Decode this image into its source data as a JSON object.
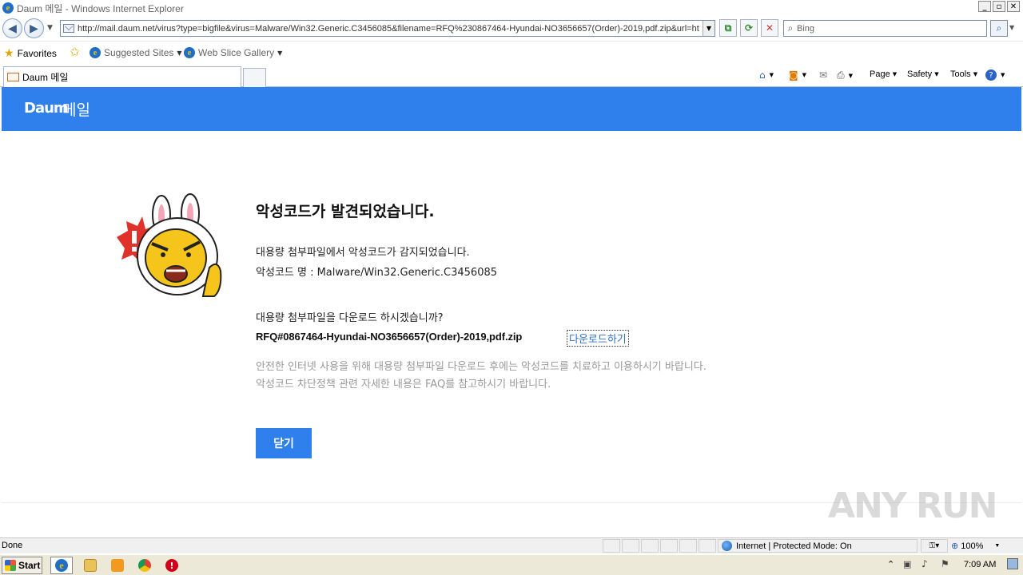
{
  "window": {
    "title": "Daum 메일 - Windows Internet Explorer",
    "minimize": "_",
    "maximize": "▫",
    "close": "✕"
  },
  "address": {
    "url": "http://mail.daum.net/virus?type=bigfile&virus=Malware/Win32.Generic.C3456085&filename=RFQ%230867464-Hyundai-NO3656657(Order)-2019,pdf.zip&url=ht",
    "search_placeholder": "Bing"
  },
  "favorites_bar": {
    "favorites_label": "Favorites",
    "suggested_sites": "Suggested Sites",
    "web_slice_gallery": "Web Slice Gallery"
  },
  "tabs": {
    "active_tab_label": "Daum 메일"
  },
  "command_bar": {
    "page": "Page",
    "safety": "Safety",
    "tools": "Tools"
  },
  "page": {
    "logo": "Daum",
    "service": "메일",
    "title": "악성코드가 발견되었습니다.",
    "desc1": "대용량 첨부파일에서 악성코드가 감지되었습니다.",
    "desc2": "악성코드 명 : Malware/Win32.Generic.C3456085",
    "question": "대용량 첨부파일을 다운로드 하시겠습니까?",
    "filename": "RFQ#0867464-Hyundai-NO3656657(Order)-2019,pdf.zip",
    "download_link": "다운로드하기",
    "note1": "안전한 인터넷 사용을 위해 대용량 첨부파일 다운로드 후에는 악성코드를 치료하고 이용하시기 바랍니다.",
    "note2": "악성코드 차단정책 관련 자세한 내용은 FAQ를 참고하시기 바랍니다.",
    "close_button": "닫기"
  },
  "status": {
    "text": "Done",
    "zone": "Internet | Protected Mode: On",
    "zoom": "100%"
  },
  "taskbar": {
    "start": "Start",
    "time": "7:09 AM"
  },
  "watermark": "ANY RUN",
  "colors": {
    "daum_blue": "#2f80ed",
    "note_gray": "#999999"
  }
}
